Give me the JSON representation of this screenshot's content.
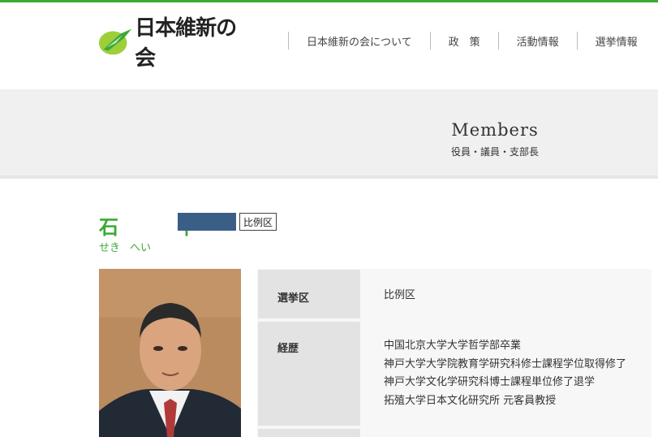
{
  "header": {
    "logo_text": "日本維新の会",
    "nav": [
      "日本維新の会について",
      "政　策",
      "活動情報",
      "選挙情報"
    ]
  },
  "band": {
    "title": "Members",
    "subtitle": "役員・議員・支部長"
  },
  "profile": {
    "name": "石　平",
    "kana": [
      "せき",
      "へい"
    ],
    "district_badge": "比例区",
    "rows": [
      {
        "label": "選挙区",
        "values": [
          "比例区"
        ]
      },
      {
        "label": "経歴",
        "values": [
          "中国北京大学大学哲学部卒業",
          "神戸大学大学院教育学研究科修士課程学位取得修了",
          "神戸大学文化学研究科博士課程単位修了退学",
          "拓殖大学日本文化研究所 元客員教授"
        ]
      }
    ]
  },
  "colors": {
    "brand_green": "#3aaa35",
    "party_badge": "#3a5f86"
  }
}
